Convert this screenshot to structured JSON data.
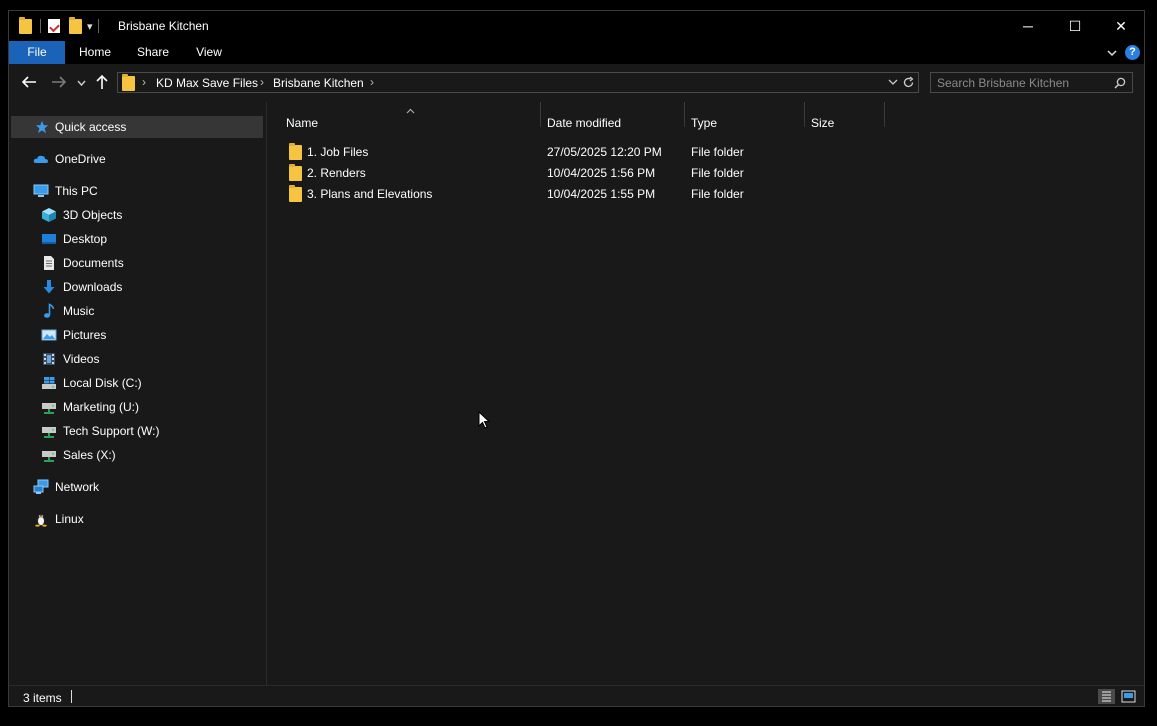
{
  "window": {
    "title": "Brisbane Kitchen",
    "qa_dropdown": "▾",
    "minimize": "─",
    "maximize": "☐",
    "close": "✕"
  },
  "ribbon": {
    "tabs": [
      "File",
      "Home",
      "Share",
      "View"
    ],
    "help": "?"
  },
  "nav": {
    "breadcrumb": [
      "KD Max Save Files",
      "Brisbane Kitchen"
    ],
    "search_placeholder": "Search Brisbane Kitchen"
  },
  "sidebar": {
    "items": [
      {
        "label": "Quick access",
        "icon": "star-icon",
        "active": true
      },
      {
        "label": "OneDrive",
        "icon": "cloud-icon"
      },
      {
        "label": "This PC",
        "icon": "computer-icon"
      },
      {
        "label": "3D Objects",
        "icon": "cube-icon"
      },
      {
        "label": "Desktop",
        "icon": "desktop-icon"
      },
      {
        "label": "Documents",
        "icon": "document-icon"
      },
      {
        "label": "Downloads",
        "icon": "download-icon"
      },
      {
        "label": "Music",
        "icon": "music-icon"
      },
      {
        "label": "Pictures",
        "icon": "picture-icon"
      },
      {
        "label": "Videos",
        "icon": "video-icon"
      },
      {
        "label": "Local Disk (C:)",
        "icon": "drive-icon"
      },
      {
        "label": "Marketing (U:)",
        "icon": "network-drive-icon"
      },
      {
        "label": "Tech Support (W:)",
        "icon": "network-drive-icon"
      },
      {
        "label": "Sales (X:)",
        "icon": "network-drive-icon"
      },
      {
        "label": "Network",
        "icon": "network-icon"
      },
      {
        "label": "Linux",
        "icon": "linux-icon"
      }
    ]
  },
  "columns": [
    "Name",
    "Date modified",
    "Type",
    "Size"
  ],
  "files": [
    {
      "name": "1. Job Files",
      "date": "27/05/2025 12:20 PM",
      "type": "File folder",
      "size": ""
    },
    {
      "name": "2. Renders",
      "date": "10/04/2025 1:56 PM",
      "type": "File folder",
      "size": ""
    },
    {
      "name": "3. Plans and Elevations",
      "date": "10/04/2025 1:55 PM",
      "type": "File folder",
      "size": ""
    }
  ],
  "status": {
    "item_count": "3 items"
  },
  "colors": {
    "accent": "#1a63b8",
    "folder": "#f5c542",
    "background": "#191919"
  }
}
